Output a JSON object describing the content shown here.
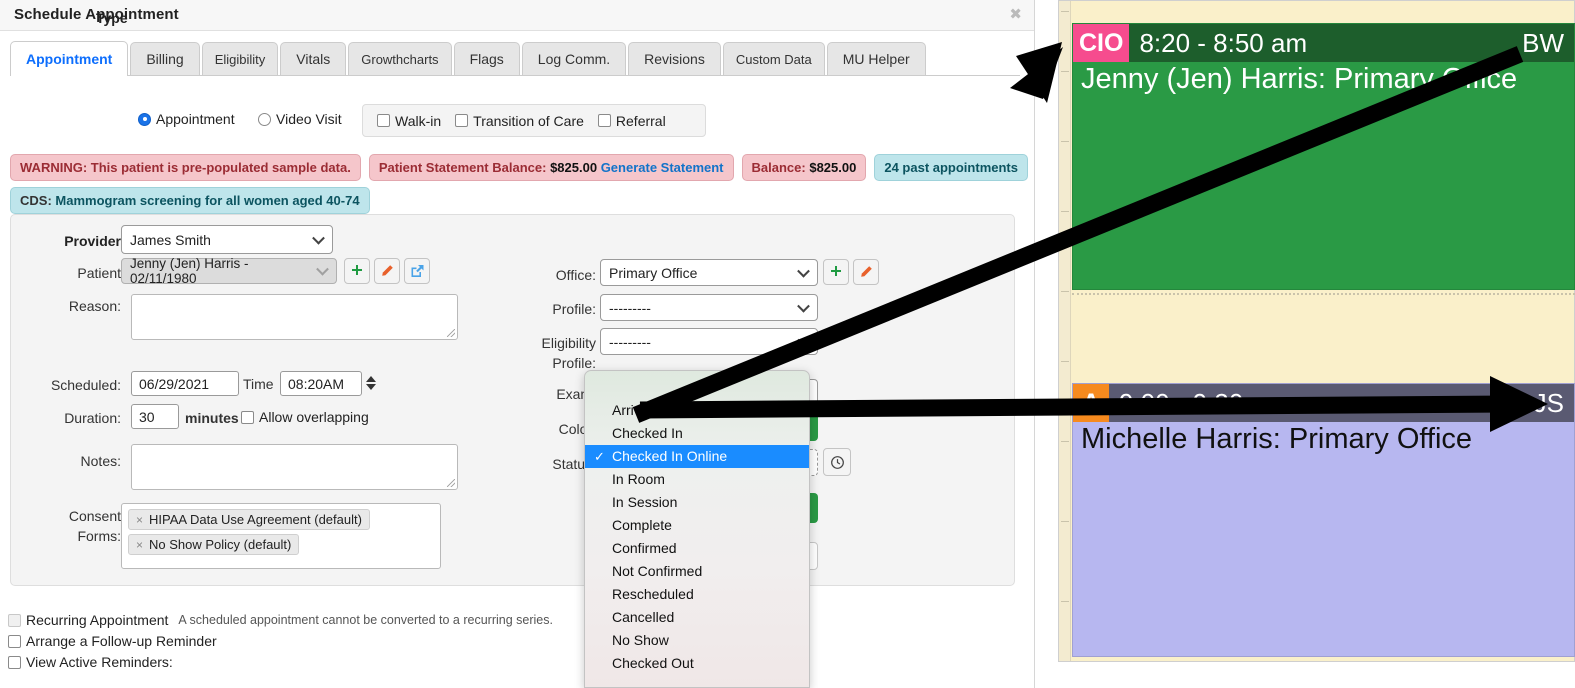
{
  "dialog": {
    "title": "Schedule Appointment",
    "close_label": "✖"
  },
  "tabs": [
    {
      "label": "Appointment",
      "active": true
    },
    {
      "label": "Billing",
      "active": false
    },
    {
      "label": "Eligibility",
      "active": false
    },
    {
      "label": "Vitals",
      "active": false
    },
    {
      "label": "Growthcharts",
      "active": false
    },
    {
      "label": "Flags",
      "active": false
    },
    {
      "label": "Log Comm.",
      "active": false
    },
    {
      "label": "Revisions",
      "active": false
    },
    {
      "label": "Custom Data",
      "active": false
    },
    {
      "label": "MU Helper",
      "active": false
    }
  ],
  "type_row": {
    "label": "Type",
    "radios": [
      {
        "label": "Appointment",
        "checked": true
      },
      {
        "label": "Video Visit",
        "checked": false
      }
    ],
    "checkboxes": [
      {
        "label": "Walk-in",
        "checked": false
      },
      {
        "label": "Transition of Care",
        "checked": false
      },
      {
        "label": "Referral",
        "checked": false
      }
    ]
  },
  "alerts": {
    "warning": "WARNING: This patient is pre-populated sample data.",
    "statement_label": "Patient Statement Balance:",
    "statement_amount": "$825.00",
    "generate_statement_link": "Generate Statement",
    "balance_label": "Balance:",
    "balance_amount": "$825.00",
    "past_appointments": "24 past appointments",
    "cds_prefix": "CDS:",
    "cds_text": "Mammogram screening for all women aged 40-74"
  },
  "form": {
    "provider_label": "Provider",
    "provider_value": "James Smith",
    "patient_label": "Patient",
    "patient_value": "Jenny (Jen) Harris - 02/11/1980",
    "reason_label": "Reason:",
    "reason_value": "",
    "scheduled_label": "Scheduled:",
    "scheduled_value": "06/29/2021",
    "time_label": "Time",
    "time_value": "08:20AM",
    "duration_label": "Duration:",
    "duration_value": "30",
    "minutes_label": "minutes",
    "allow_overlapping_label": "Allow overlapping",
    "notes_label": "Notes:",
    "notes_value": "",
    "consent_label_line1": "Consent",
    "consent_label_line2": "Forms:",
    "consent_chips": [
      "HIPAA Data Use Agreement (default)",
      "No Show Policy (default)"
    ],
    "office_label": "Office:",
    "office_value": "Primary Office",
    "profile_label": "Profile:",
    "profile_value": "---------",
    "eligibility_label_line1": "Eligibility",
    "eligibility_label_line2": "Profile:",
    "eligibility_value": "---------",
    "exam_label": "Exam:",
    "color_label": "Color:",
    "status_label": "Status:",
    "chip_remove_icon": "×"
  },
  "status_menu": {
    "options": [
      {
        "label": "Arrived",
        "selected": false
      },
      {
        "label": "Checked In",
        "selected": false
      },
      {
        "label": "Checked In Online",
        "selected": true
      },
      {
        "label": "In Room",
        "selected": false
      },
      {
        "label": "In Session",
        "selected": false
      },
      {
        "label": "Complete",
        "selected": false
      },
      {
        "label": "Confirmed",
        "selected": false
      },
      {
        "label": "Not Confirmed",
        "selected": false
      },
      {
        "label": "Rescheduled",
        "selected": false
      },
      {
        "label": "Cancelled",
        "selected": false
      },
      {
        "label": "No Show",
        "selected": false
      },
      {
        "label": "Checked Out",
        "selected": false
      }
    ],
    "selected_value": "Checked In Online",
    "highlight_color": "#1a8cff"
  },
  "bottom_options": [
    {
      "label": "Recurring Appointment",
      "checked": false,
      "disabled": true,
      "hint": "A scheduled appointment cannot be converted to a recurring series."
    },
    {
      "label": "Arrange a Follow-up Reminder",
      "checked": false,
      "disabled": false,
      "hint": ""
    },
    {
      "label": "View Active Reminders:",
      "checked": false,
      "disabled": false,
      "hint": ""
    }
  ],
  "calendar": {
    "background_color": "#faf0ca",
    "appointments": [
      {
        "flag": "CIO",
        "flag_color": "#f64c8e",
        "time": "8:20 - 8:50 am",
        "initials": "BW",
        "title": "Jenny (Jen) Harris: Primary Office",
        "header_color": "#1d5e2c",
        "body_color": "#2a9a45",
        "text_color": "#ffffff"
      },
      {
        "flag": "A",
        "flag_color": "#f68a1e",
        "time": "9:00 - 9:30 am",
        "initials": "JS",
        "title": "Michelle Harris: Primary Office",
        "header_color": "#5a5a72",
        "body_color": "#b7b7f0",
        "text_color": "#111111"
      }
    ]
  },
  "annotations": {
    "arrow_1_name": "arrow-to-checked-in-online-appointment",
    "arrow_2_name": "arrow-to-arrived-appointment"
  }
}
